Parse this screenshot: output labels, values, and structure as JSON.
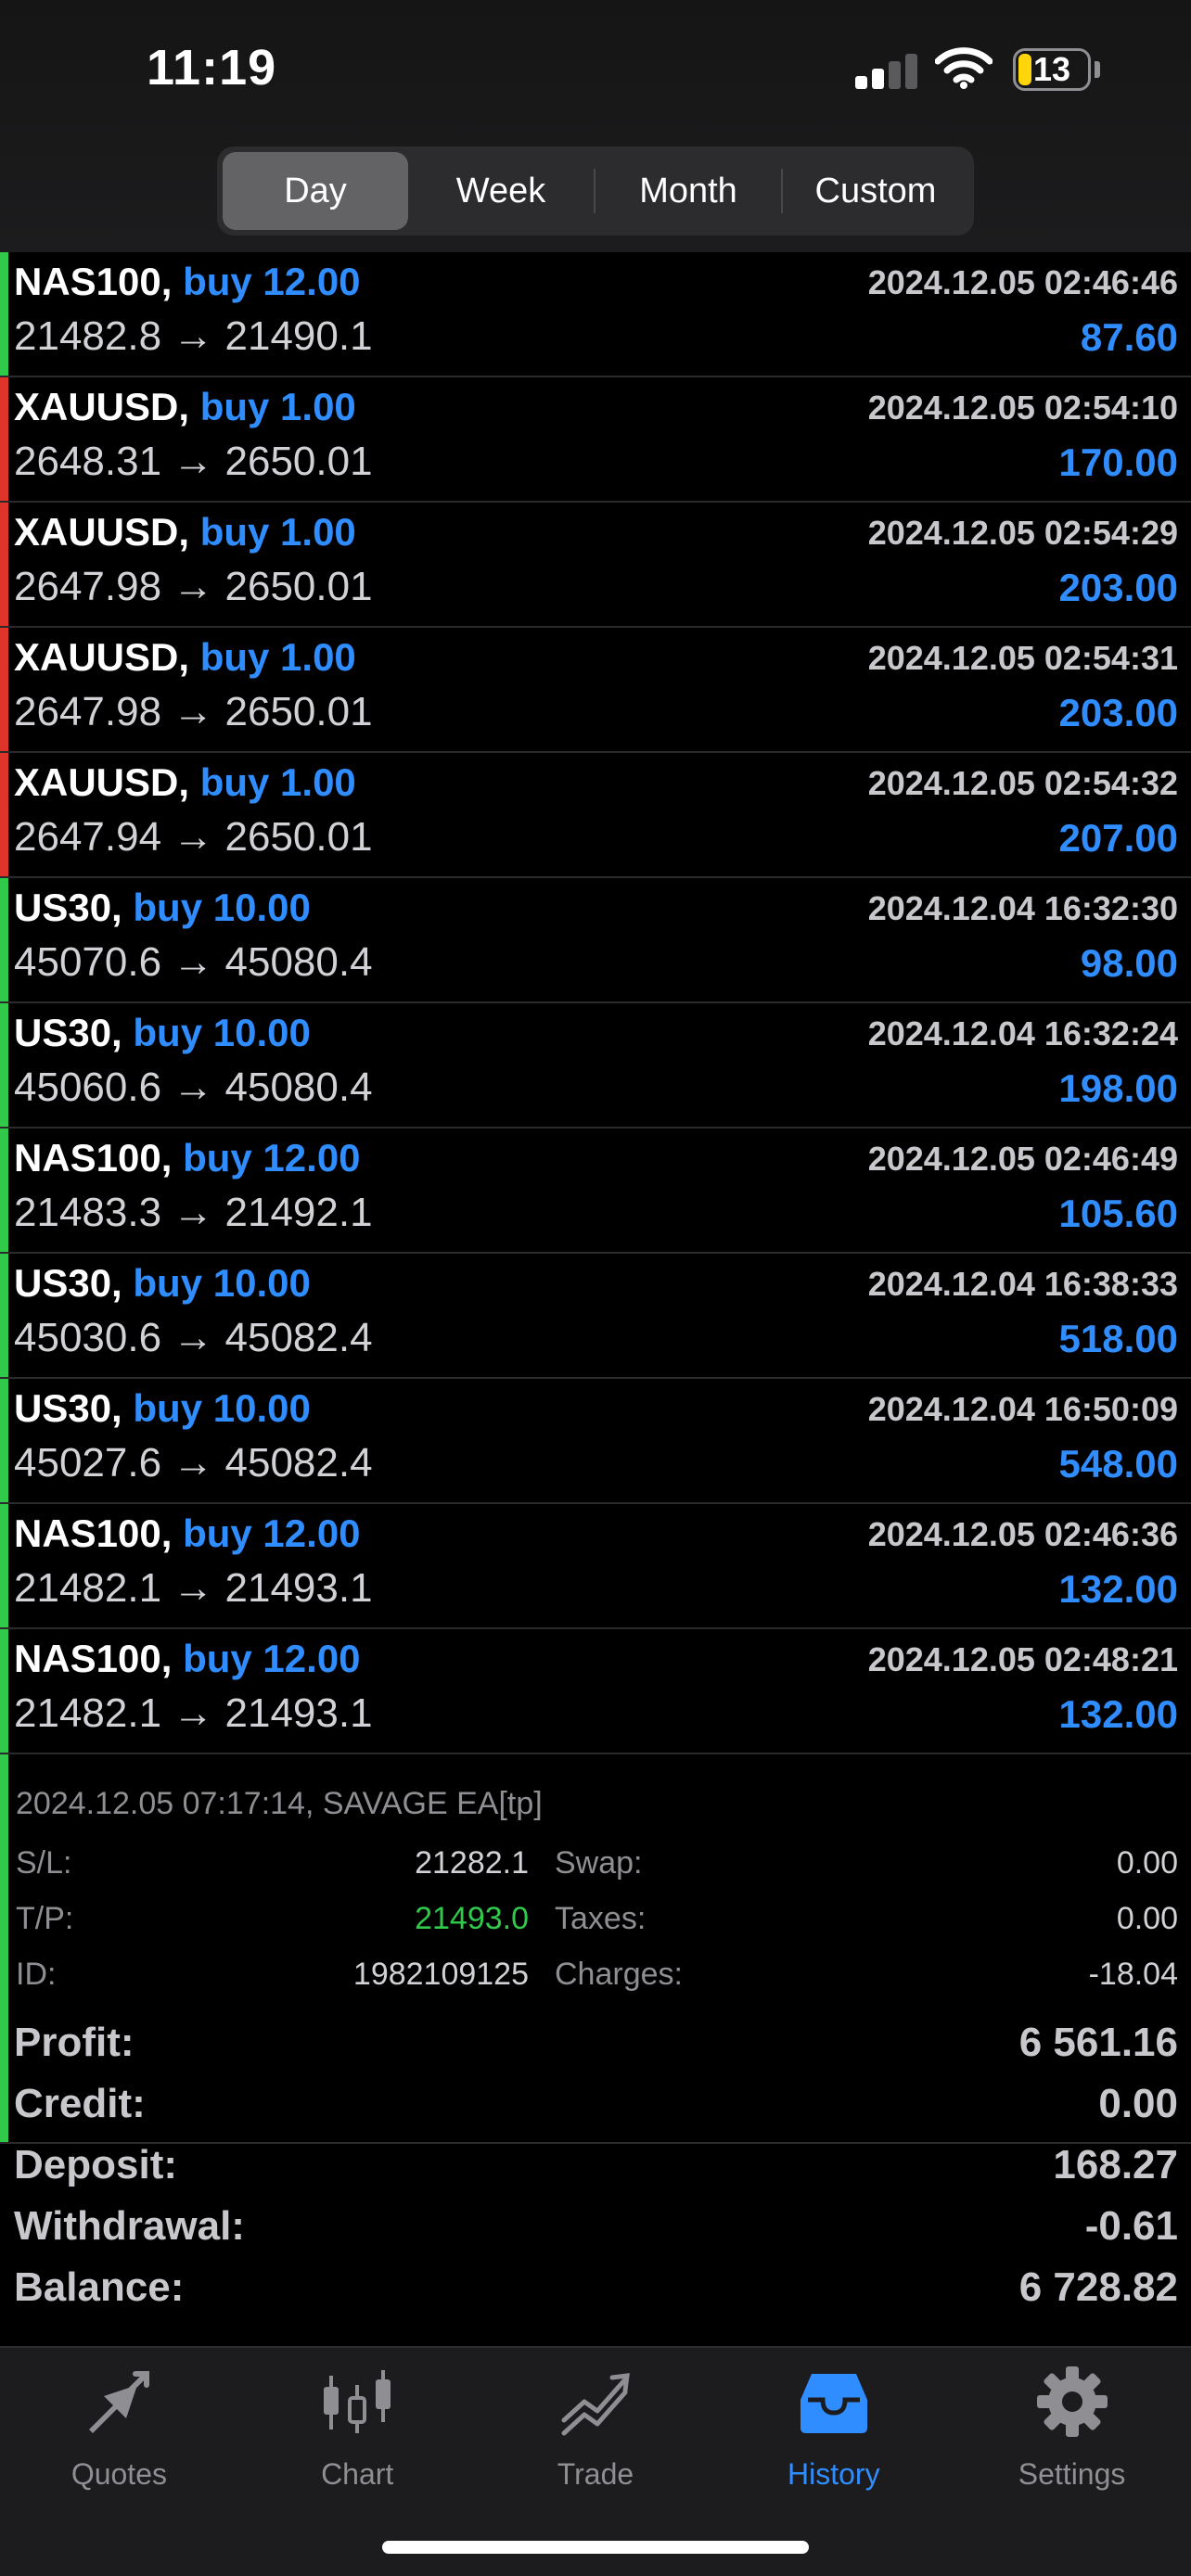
{
  "status_bar": {
    "time": "11:19",
    "battery": "13"
  },
  "period_tabs": [
    {
      "label": "Day",
      "active": true
    },
    {
      "label": "Week",
      "active": false
    },
    {
      "label": "Month",
      "active": false
    },
    {
      "label": "Custom",
      "active": false
    }
  ],
  "trades": [
    {
      "symbol": "NAS100,",
      "side": "buy 12.00",
      "time": "2024.12.05 02:46:46",
      "prices": "21482.8 → 21490.1",
      "profit": "87.60",
      "marker": "green"
    },
    {
      "symbol": "XAUUSD,",
      "side": "buy 1.00",
      "time": "2024.12.05 02:54:10",
      "prices": "2648.31 → 2650.01",
      "profit": "170.00",
      "marker": "red"
    },
    {
      "symbol": "XAUUSD,",
      "side": "buy 1.00",
      "time": "2024.12.05 02:54:29",
      "prices": "2647.98 → 2650.01",
      "profit": "203.00",
      "marker": "red"
    },
    {
      "symbol": "XAUUSD,",
      "side": "buy 1.00",
      "time": "2024.12.05 02:54:31",
      "prices": "2647.98 → 2650.01",
      "profit": "203.00",
      "marker": "red"
    },
    {
      "symbol": "XAUUSD,",
      "side": "buy 1.00",
      "time": "2024.12.05 02:54:32",
      "prices": "2647.94 → 2650.01",
      "profit": "207.00",
      "marker": "red"
    },
    {
      "symbol": "US30,",
      "side": "buy 10.00",
      "time": "2024.12.04 16:32:30",
      "prices": "45070.6 → 45080.4",
      "profit": "98.00",
      "marker": "green"
    },
    {
      "symbol": "US30,",
      "side": "buy 10.00",
      "time": "2024.12.04 16:32:24",
      "prices": "45060.6 → 45080.4",
      "profit": "198.00",
      "marker": "green"
    },
    {
      "symbol": "NAS100,",
      "side": "buy 12.00",
      "time": "2024.12.05 02:46:49",
      "prices": "21483.3 → 21492.1",
      "profit": "105.60",
      "marker": "green"
    },
    {
      "symbol": "US30,",
      "side": "buy 10.00",
      "time": "2024.12.04 16:38:33",
      "prices": "45030.6 → 45082.4",
      "profit": "518.00",
      "marker": "green"
    },
    {
      "symbol": "US30,",
      "side": "buy 10.00",
      "time": "2024.12.04 16:50:09",
      "prices": "45027.6 → 45082.4",
      "profit": "548.00",
      "marker": "green"
    },
    {
      "symbol": "NAS100,",
      "side": "buy 12.00",
      "time": "2024.12.05 02:46:36",
      "prices": "21482.1 → 21493.1",
      "profit": "132.00",
      "marker": "green"
    },
    {
      "symbol": "NAS100,",
      "side": "buy 12.00",
      "time": "2024.12.05 02:48:21",
      "prices": "21482.1 → 21493.1",
      "profit": "132.00",
      "marker": "green"
    }
  ],
  "detail": {
    "comment": "2024.12.05 07:17:14, SAVAGE EA[tp]",
    "sl_label": "S/L:",
    "sl_value": "21282.1",
    "tp_label": "T/P:",
    "tp_value": "21493.0",
    "id_label": "ID:",
    "id_value": "1982109125",
    "swap_label": "Swap:",
    "swap_value": "0.00",
    "taxes_label": "Taxes:",
    "taxes_value": "0.00",
    "charges_label": "Charges:",
    "charges_value": "-18.04"
  },
  "summary": [
    {
      "label": "Profit:",
      "value": "6 561.16"
    },
    {
      "label": "Credit:",
      "value": "0.00"
    },
    {
      "label": "Deposit:",
      "value": "168.27"
    },
    {
      "label": "Withdrawal:",
      "value": "-0.61"
    },
    {
      "label": "Balance:",
      "value": "6 728.82"
    }
  ],
  "tabbar": [
    {
      "label": "Quotes",
      "icon": "quotes-icon",
      "active": false
    },
    {
      "label": "Chart",
      "icon": "chart-icon",
      "active": false
    },
    {
      "label": "Trade",
      "icon": "trade-icon",
      "active": false
    },
    {
      "label": "History",
      "icon": "history-icon",
      "active": true
    },
    {
      "label": "Settings",
      "icon": "gear-icon",
      "active": false
    }
  ],
  "colors": {
    "accent": "#2f8dff",
    "profit_marker": "#30c94a",
    "loss_marker": "#e0342b",
    "tp_value": "#30c94a"
  }
}
